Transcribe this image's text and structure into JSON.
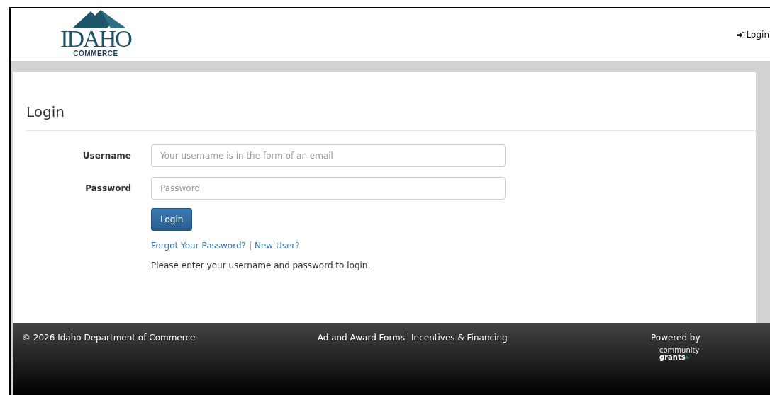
{
  "header": {
    "logo": {
      "name": "IDAHO",
      "subtitle": "COMMERCE"
    },
    "login_link": "Login"
  },
  "panel": {
    "title": "Login",
    "fields": [
      {
        "label": "Username",
        "placeholder": "Your username is in the form of an email"
      },
      {
        "label": "Password",
        "placeholder": "Password"
      }
    ],
    "button": "Login",
    "links": [
      "Forgot Your Password?",
      "New User?"
    ],
    "link_separator": "|",
    "message": "Please enter your username and password to login."
  },
  "footer": {
    "copyright": "© 2026 Idaho Department of Commerce",
    "links": [
      "Ad and Award Forms",
      "Incentives & Financing"
    ],
    "powered_by": "Powered by",
    "brand": {
      "line1": "community",
      "line2": "grants",
      "mark": "»"
    }
  }
}
